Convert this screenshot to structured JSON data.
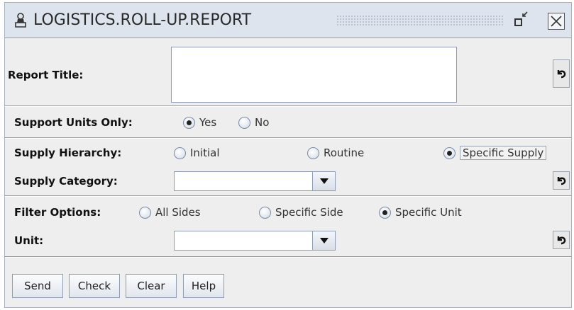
{
  "window": {
    "title": "LOGISTICS.ROLL-UP.REPORT",
    "icons": {
      "app": "person-desk-icon",
      "minimize": "restore-icon",
      "close": "close-icon"
    }
  },
  "report_title": {
    "label": "Report Title:",
    "value": ""
  },
  "support_units_only": {
    "label": "Support Units Only:",
    "options": [
      "Yes",
      "No"
    ],
    "selected": "Yes"
  },
  "supply_hierarchy": {
    "label": "Supply Hierarchy:",
    "options": [
      "Initial",
      "Routine",
      "Specific Supply"
    ],
    "selected": "Specific Supply"
  },
  "supply_category": {
    "label": "Supply Category:",
    "value": ""
  },
  "filter_options": {
    "label": "Filter Options:",
    "options": [
      "All Sides",
      "Specific Side",
      "Specific Unit"
    ],
    "selected": "Specific Unit"
  },
  "unit": {
    "label": "Unit:",
    "value": ""
  },
  "buttons": {
    "send": "Send",
    "check": "Check",
    "clear": "Clear",
    "help": "Help"
  },
  "colors": {
    "titlebar_bg": "#dde4ee",
    "panel_bg": "#eeeeee",
    "border": "#8e9bb0"
  }
}
